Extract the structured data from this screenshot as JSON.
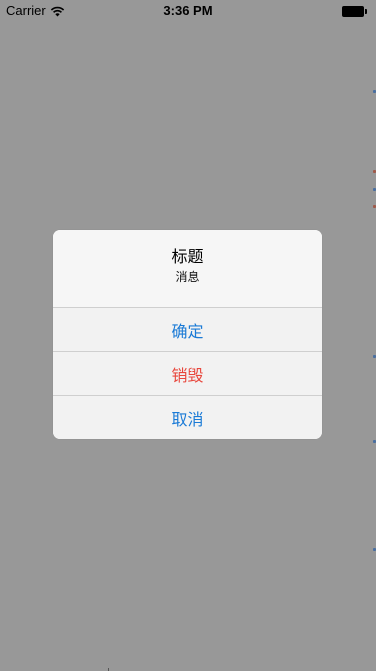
{
  "status_bar": {
    "carrier": "Carrier",
    "time": "3:36 PM",
    "wifi_icon": "wifi-icon",
    "battery_icon": "battery-full-icon"
  },
  "alert": {
    "title": "标题",
    "message": "消息",
    "buttons": [
      {
        "label": "确定",
        "style": "default",
        "color": "#1a7ad6"
      },
      {
        "label": "销毁",
        "style": "destructive",
        "color": "#e8473d"
      },
      {
        "label": "取消",
        "style": "cancel",
        "color": "#1a7ad6"
      }
    ]
  },
  "colors": {
    "dim_overlay": "#989898",
    "alert_background": "#f4f4f4",
    "separator": "#cfcfcf"
  }
}
